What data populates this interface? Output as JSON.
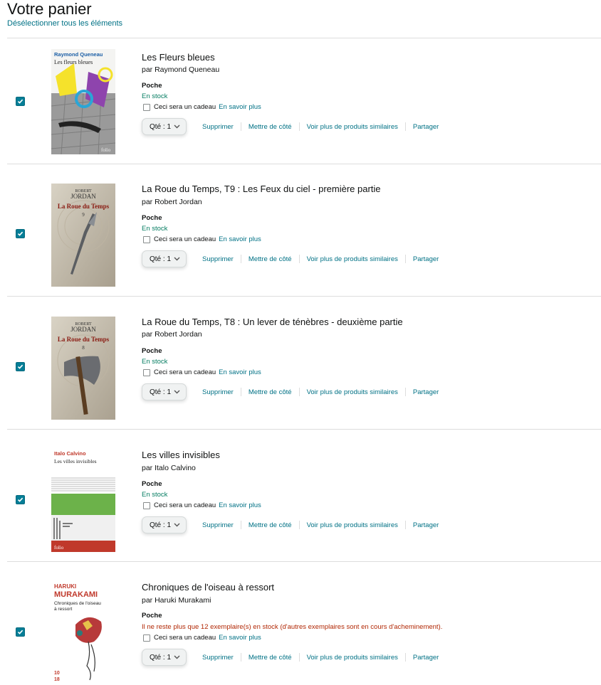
{
  "header": {
    "title": "Votre panier",
    "deselect_label": "Désélectionner tous les éléments"
  },
  "actions": {
    "qty_label": "Qté : 1",
    "delete": "Supprimer",
    "save_for_later": "Mettre de côté",
    "see_similar": "Voir plus de produits similaires",
    "share": "Partager",
    "gift_label": "Ceci sera un cadeau",
    "learn_more": "En savoir plus"
  },
  "items": [
    {
      "title": "Les Fleurs bleues",
      "author": "par Raymond Queneau",
      "format": "Poche",
      "stock": "En stock",
      "selected": true,
      "cover": {
        "author": "Raymond Queneau",
        "title": "Les fleurs bleues",
        "publisher": "folio"
      }
    },
    {
      "title": "La Roue du Temps, T9 : Les Feux du ciel - première partie",
      "author": "par Robert Jordan",
      "format": "Poche",
      "stock": "En stock",
      "selected": true,
      "cover": {
        "author_line1": "ROBERT",
        "author_line2": "JORDAN",
        "series": "La Roue du Temps",
        "number": "9"
      }
    },
    {
      "title": "La Roue du Temps, T8 : Un lever de ténèbres - deuxième partie",
      "author": "par Robert Jordan",
      "format": "Poche",
      "stock": "En stock",
      "selected": true,
      "cover": {
        "author_line1": "ROBERT",
        "author_line2": "JORDAN",
        "series": "La Roue du Temps",
        "number": "8"
      }
    },
    {
      "title": "Les villes invisibles",
      "author": "par Italo Calvino",
      "format": "Poche",
      "stock": "En stock",
      "selected": true,
      "cover": {
        "author": "Italo Calvino",
        "title": "Les villes invisibles",
        "publisher": "folio"
      }
    },
    {
      "title": "Chroniques de l'oiseau à ressort",
      "author": "par Haruki Murakami",
      "format": "Poche",
      "stock": "Il ne reste plus que 12 exemplaire(s) en stock (d'autres exemplaires sont en cours d'acheminement).",
      "selected": true,
      "cover": {
        "author_line1": "HARUKI",
        "author_line2": "MURAKAMI",
        "title_line1": "Chroniques de l'oiseau",
        "title_line2": "à ressort",
        "publisher_top": "10",
        "publisher_bottom": "18"
      }
    }
  ],
  "colors": {
    "link": "#007185",
    "in_stock": "#067d62",
    "low_stock": "#b12704",
    "checkbox": "#057e97"
  }
}
